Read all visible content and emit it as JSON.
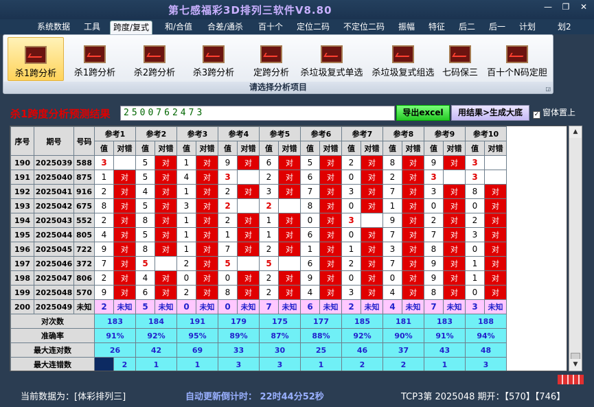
{
  "app": {
    "title": "第七感福彩3D排列三软件V8.80"
  },
  "menu": [
    "系统数据",
    "工具",
    "跨度/复式",
    "和/合值",
    "合差/通杀",
    "百十个",
    "定位二码",
    "不定位二码",
    "振幅",
    "特征",
    "后二",
    "后一",
    "计划",
    "划2"
  ],
  "menu_active": "跨度/复式",
  "ribbon": {
    "buttons": [
      "杀1跨分析",
      "杀1跨分析",
      "杀2跨分析",
      "杀3跨分析",
      "定跨分析",
      "杀垃圾复式单选",
      "杀垃圾复式组选",
      "七码保三",
      "百十个N码定胆"
    ],
    "selected": 0,
    "group_label": "请选择分析项目"
  },
  "result": {
    "label": "杀1跨度分析预测结果",
    "value": "2500762473",
    "export_button": "导出excel",
    "generate_button": "用结果>生成大底",
    "ontop_label": "窗体置上",
    "ontop_checked": true
  },
  "chart_data": {
    "type": "table",
    "headers": {
      "seq": "序号",
      "period": "期号",
      "number": "号码",
      "value_col": "值",
      "result_col": "对错"
    },
    "references": [
      "参考1",
      "参考2",
      "参考3",
      "参考4",
      "参考5",
      "参考6",
      "参考7",
      "参考8",
      "参考9",
      "参考10"
    ],
    "rows": [
      {
        "seq": "190",
        "period": "2025039",
        "number": "588",
        "vals": [
          "3",
          "5",
          "1",
          "9",
          "6",
          "5",
          "2",
          "8",
          "9",
          "3"
        ],
        "miss": [
          true,
          false,
          false,
          false,
          false,
          false,
          false,
          false,
          false,
          true
        ]
      },
      {
        "seq": "191",
        "period": "2025040",
        "number": "875",
        "vals": [
          "1",
          "5",
          "4",
          "3",
          "2",
          "6",
          "0",
          "2",
          "3",
          "3"
        ],
        "miss": [
          false,
          false,
          false,
          true,
          false,
          false,
          false,
          false,
          true,
          true
        ]
      },
      {
        "seq": "192",
        "period": "2025041",
        "number": "916",
        "vals": [
          "2",
          "4",
          "1",
          "2",
          "3",
          "7",
          "3",
          "7",
          "3",
          "8"
        ],
        "miss": [
          false,
          false,
          false,
          false,
          false,
          false,
          false,
          false,
          false,
          false
        ]
      },
      {
        "seq": "193",
        "period": "2025042",
        "number": "675",
        "vals": [
          "8",
          "5",
          "3",
          "2",
          "2",
          "8",
          "0",
          "1",
          "0",
          "0"
        ],
        "miss": [
          false,
          false,
          false,
          true,
          true,
          false,
          false,
          false,
          false,
          false
        ]
      },
      {
        "seq": "194",
        "period": "2025043",
        "number": "552",
        "vals": [
          "2",
          "8",
          "1",
          "2",
          "1",
          "0",
          "3",
          "9",
          "2",
          "2"
        ],
        "miss": [
          false,
          false,
          false,
          false,
          false,
          false,
          true,
          false,
          false,
          false
        ]
      },
      {
        "seq": "195",
        "period": "2025044",
        "number": "805",
        "vals": [
          "4",
          "5",
          "1",
          "1",
          "1",
          "6",
          "0",
          "7",
          "7",
          "3"
        ],
        "miss": [
          false,
          false,
          false,
          false,
          false,
          false,
          false,
          false,
          false,
          false
        ]
      },
      {
        "seq": "196",
        "period": "2025045",
        "number": "722",
        "vals": [
          "9",
          "8",
          "1",
          "7",
          "2",
          "1",
          "1",
          "3",
          "8",
          "0"
        ],
        "miss": [
          false,
          false,
          false,
          false,
          false,
          false,
          false,
          false,
          false,
          false
        ]
      },
      {
        "seq": "197",
        "period": "2025046",
        "number": "372",
        "vals": [
          "7",
          "5",
          "2",
          "5",
          "5",
          "6",
          "2",
          "7",
          "9",
          "1"
        ],
        "miss": [
          false,
          true,
          false,
          true,
          true,
          false,
          false,
          false,
          false,
          false
        ]
      },
      {
        "seq": "198",
        "period": "2025047",
        "number": "806",
        "vals": [
          "2",
          "4",
          "0",
          "0",
          "2",
          "9",
          "0",
          "0",
          "9",
          "1"
        ],
        "miss": [
          false,
          false,
          false,
          false,
          false,
          false,
          false,
          false,
          false,
          false
        ]
      },
      {
        "seq": "199",
        "period": "2025048",
        "number": "570",
        "vals": [
          "9",
          "6",
          "2",
          "8",
          "2",
          "4",
          "3",
          "4",
          "8",
          "0"
        ],
        "miss": [
          false,
          false,
          false,
          false,
          false,
          false,
          false,
          false,
          false,
          false
        ]
      },
      {
        "seq": "200",
        "period": "2025049",
        "number": "未知",
        "vals": [
          "2",
          "5",
          "0",
          "0",
          "7",
          "6",
          "2",
          "4",
          "7",
          "3"
        ],
        "miss": [
          false,
          false,
          false,
          false,
          false,
          false,
          false,
          false,
          false,
          false
        ],
        "unknown": true
      }
    ],
    "unknown_label": "未知",
    "correct_label": "对",
    "stats": [
      {
        "label": "对次数",
        "values": [
          "183",
          "184",
          "191",
          "179",
          "175",
          "177",
          "185",
          "181",
          "183",
          "188"
        ]
      },
      {
        "label": "准确率",
        "values": [
          "91%",
          "92%",
          "95%",
          "89%",
          "87%",
          "88%",
          "92%",
          "90%",
          "91%",
          "94%"
        ]
      },
      {
        "label": "最大连对数",
        "values": [
          "26",
          "42",
          "69",
          "33",
          "30",
          "25",
          "46",
          "37",
          "43",
          "48"
        ]
      },
      {
        "label": "最大连错数",
        "values": [
          "2",
          "1",
          "1",
          "3",
          "3",
          "1",
          "2",
          "2",
          "1",
          "3"
        ]
      }
    ]
  },
  "status": {
    "current_data": "当前数据为：[体彩排列三]",
    "countdown": "自动更新倒计时：  22时44分52秒",
    "draw": "TCP3第 2025048 期开：【570】【746】"
  },
  "colors": {
    "miss": "#e00000",
    "stats_bg": "#70f0f6",
    "unknown_bg": "#ffc8ff",
    "stats_text": "#2222cc"
  }
}
